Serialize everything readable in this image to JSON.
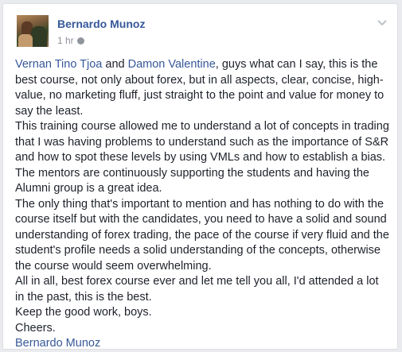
{
  "post": {
    "author": "Bernardo Munoz",
    "time": "1 hr",
    "icons": {
      "privacy": "globe-icon",
      "menu": "chevron-down-icon"
    },
    "colors": {
      "link": "#365899",
      "text": "#1d2129",
      "meta": "#90949c"
    },
    "body": {
      "p1": {
        "mention1": "Vernan Tino Tjoa",
        "and": " and ",
        "mention2": "Damon Valentine",
        "rest": ", guys what can I say, this is the best course, not only about forex, but in all aspects, clear, concise, high-value, no marketing fluff, just straight to the point and value for money to say the least."
      },
      "p2": "This training course allowed me to understand a lot of concepts in trading that I was having problems to understand such as the importance of S&R and how to spot these levels by using VMLs and how to establish a bias.",
      "p3": "The mentors are continuously supporting the students and having the Alumni group is a great idea.",
      "p4": "The only thing that's important to mention and has nothing to do with the course itself but with the candidates, you need to have a solid and sound understanding of forex trading, the pace of the course if very fluid and the student's profile needs a solid understanding of the concepts, otherwise the course would seem overwhelming.",
      "p5": "All in all, best forex course ever and let me tell you all, I'd attended a lot in the past, this is the best.",
      "p6": "Keep the good work, boys.",
      "p7": "Cheers.",
      "signature": "Bernardo Munoz"
    }
  }
}
